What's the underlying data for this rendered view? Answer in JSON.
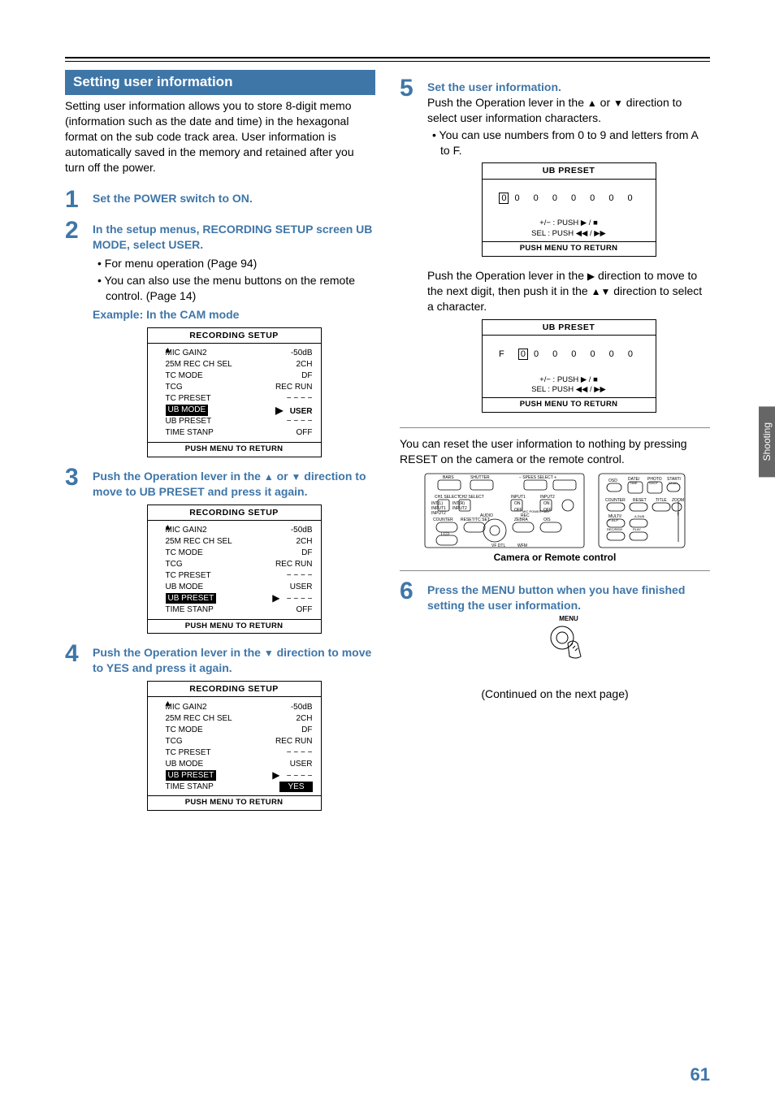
{
  "side_tab": "Shooting",
  "page_number": "61",
  "continued": "(Continued on the next page)",
  "section": {
    "title": "Setting user information",
    "intro": "Setting user information allows you to store 8-digit memo (information such as the date and time) in the hexagonal format on the sub code track area. User information is automatically saved in the memory and retained after you turn off the power."
  },
  "steps": {
    "s1": {
      "num": "1",
      "title": "Set the POWER switch to ON."
    },
    "s2": {
      "num": "2",
      "title": "In the setup menus, RECORDING SETUP screen UB MODE, select USER.",
      "b1": "For menu operation (Page  94)",
      "b2": "You can also use the menu buttons on the remote control. (Page 14)",
      "example_label": "Example: In the CAM mode"
    },
    "s3": {
      "num": "3",
      "title_a": "Push the Operation lever in the ",
      "title_b": " or ",
      "title_c": " direction to move to UB PRESET and press it again."
    },
    "s4": {
      "num": "4",
      "title_a": "Push the Operation lever in the ",
      "title_b": " direction to move to YES and press it again."
    },
    "s5": {
      "num": "5",
      "title": "Set the user information.",
      "line_a": "Push the Operation lever in the ",
      "line_b": " or ",
      "line_c": " direction to select user information characters.",
      "b1": "You can use numbers from 0 to 9 and letters from A to F.",
      "mid_a": "Push the Operation lever in the ",
      "mid_b": " direction to move to the next digit, then push it in the ",
      "mid_c": " direction to select a character.",
      "reset": "You can reset the user information to nothing by pressing RESET on the camera or the remote control."
    },
    "s6": {
      "num": "6",
      "title": "Press the MENU button when you have finished setting the user information."
    }
  },
  "osd_common": {
    "title_rec": "RECORDING  SETUP",
    "title_ub": "UB PRESET",
    "footer": "PUSH  MENU TO RETURN",
    "ctrl1": "+/− : PUSH ▶ / ■",
    "ctrl2": "SEL : PUSH ◀◀ / ▶▶",
    "rows": {
      "mic": {
        "lab": "MIC GAIN2",
        "val": "-50dB"
      },
      "ch": {
        "lab": "25M REC CH SEL",
        "val": "2CH"
      },
      "tcm": {
        "lab": "TC MODE",
        "val": "DF"
      },
      "tcg": {
        "lab": "TCG",
        "val": "REC RUN"
      },
      "tcp": {
        "lab": "TC PRESET",
        "val": "− − − −"
      },
      "ubm": {
        "lab": "UB MODE",
        "val": "USER"
      },
      "ubp": {
        "lab": "UB PRESET",
        "val": "− − − −"
      },
      "ts": {
        "lab": "TIME STANP",
        "val": "OFF"
      },
      "ts_yes": {
        "lab": "TIME STANP",
        "val": "YES"
      }
    }
  },
  "ub_screens": {
    "a": {
      "prefix": "",
      "boxed": "0",
      "rest": "0 0 0 0 0 0 0"
    },
    "b": {
      "prefix": "F ",
      "boxed": "0",
      "rest": "0 0 0 0 0 0"
    }
  },
  "diagram_caption": "Camera or Remote control",
  "menu_label": "MENU"
}
